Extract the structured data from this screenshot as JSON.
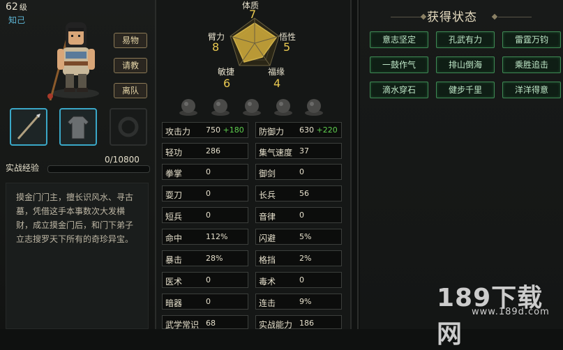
{
  "character": {
    "level_number": "62",
    "level_unit": "级",
    "relation": "知己",
    "buttons": {
      "trade": "易物",
      "consult": "请教",
      "leave": "离队"
    },
    "exp_label": "实战经验",
    "exp_value": "0/10800",
    "exp_fraction": 0,
    "description": "摸金门门主，擅长识风水、寻古墓，凭借这手本事数次大发横财，成立摸金门后，和门下弟子立志搜罗天下所有的奇珍异宝。"
  },
  "attributes": {
    "tizhi": {
      "label": "体质",
      "value": "7"
    },
    "bili": {
      "label": "臂力",
      "value": "8"
    },
    "wuxing": {
      "label": "悟性",
      "value": "5"
    },
    "minjie": {
      "label": "敏捷",
      "value": "6"
    },
    "fuyuan": {
      "label": "福缘",
      "value": "4"
    }
  },
  "stats": {
    "attack": {
      "label": "攻击力",
      "value": "750",
      "bonus": "+180"
    },
    "defense": {
      "label": "防御力",
      "value": "630",
      "bonus": "+220"
    },
    "qinggong": {
      "label": "轻功",
      "value": "286"
    },
    "qi_speed": {
      "label": "集气速度",
      "value": "37"
    },
    "quanzhang": {
      "label": "拳掌",
      "value": "0"
    },
    "yujian": {
      "label": "御剑",
      "value": "0"
    },
    "shuadao": {
      "label": "耍刀",
      "value": "0"
    },
    "changbing": {
      "label": "长兵",
      "value": "56"
    },
    "duanbing": {
      "label": "短兵",
      "value": "0"
    },
    "yinlv": {
      "label": "音律",
      "value": "0"
    },
    "mingzhong": {
      "label": "命中",
      "value": "112%"
    },
    "shanbi": {
      "label": "闪避",
      "value": "5%"
    },
    "baoji": {
      "label": "暴击",
      "value": "28%"
    },
    "gedang": {
      "label": "格挡",
      "value": "2%"
    },
    "yishu": {
      "label": "医术",
      "value": "0"
    },
    "dushu": {
      "label": "毒术",
      "value": "0"
    },
    "anqi": {
      "label": "暗器",
      "value": "0"
    },
    "lianji": {
      "label": "连击",
      "value": "9%"
    },
    "wuxue": {
      "label": "武学常识",
      "value": "68"
    },
    "shizhan": {
      "label": "实战能力",
      "value": "186"
    }
  },
  "status_panel": {
    "title": "获得状态",
    "items": [
      "意志坚定",
      "孔武有力",
      "雷霆万钧",
      "一鼓作气",
      "排山倒海",
      "乘胜追击",
      "滴水穿石",
      "健步千里",
      "洋洋得意"
    ]
  },
  "watermark": {
    "main": "189下载网",
    "sub": "www.189d.com"
  },
  "colors": {
    "bonus": "#5fcf4f",
    "relation": "#5fb8d8",
    "status_border": "#3e8a54",
    "equip_border": "#3aa8c8"
  }
}
